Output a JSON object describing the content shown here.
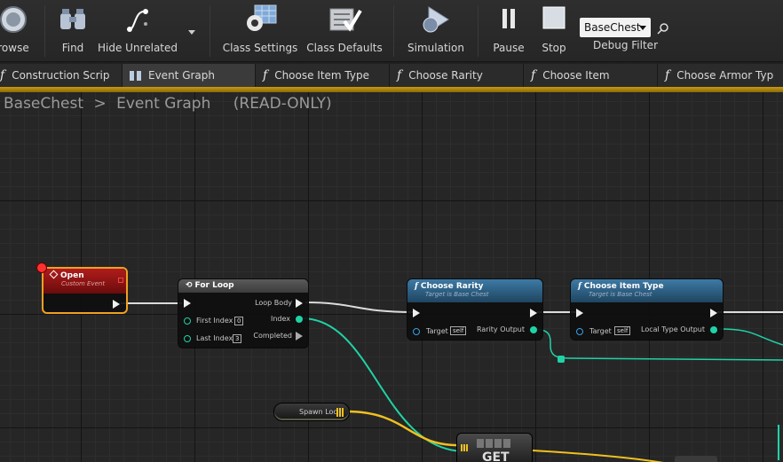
{
  "toolbar": {
    "browse": "rowse",
    "find": "Find",
    "hide_unrelated": "Hide Unrelated",
    "class_settings": "Class Settings",
    "class_defaults": "Class Defaults",
    "simulation": "Simulation",
    "pause": "Pause",
    "stop": "Stop",
    "debug_object": "BaseChest",
    "debug_filter": "Debug Filter"
  },
  "tabs": [
    {
      "label": "Construction Scrip",
      "icon": "function-icon"
    },
    {
      "label": "Event Graph",
      "icon": "graph-icon"
    },
    {
      "label": "Choose Item Type",
      "icon": "function-icon"
    },
    {
      "label": "Choose Rarity",
      "icon": "function-icon"
    },
    {
      "label": "Choose Item",
      "icon": "function-icon"
    },
    {
      "label": "Choose Armor Typ",
      "icon": "function-icon"
    }
  ],
  "breadcrumb": {
    "blueprint": "BaseChest",
    "sep": ">",
    "graph": "Event Graph",
    "mode": "(READ-ONLY)"
  },
  "nodes": {
    "open": {
      "title": "Open",
      "subtitle": "Custom Event"
    },
    "for_loop": {
      "title": "For Loop",
      "first_index_label": "First Index",
      "first_index_value": "0",
      "last_index_label": "Last Index",
      "last_index_value": "3",
      "loop_body": "Loop Body",
      "index": "Index",
      "completed": "Completed"
    },
    "choose_rarity": {
      "title": "Choose Rarity",
      "subtitle": "Target is Base Chest",
      "target_label": "Target",
      "target_value": "self",
      "output": "Rarity Output"
    },
    "choose_item_type": {
      "title": "Choose Item Type",
      "subtitle": "Target is Base Chest",
      "target_label": "Target",
      "target_value": "self",
      "output": "Local Type Output"
    },
    "spawn_loc": {
      "label": "Spawn Loc"
    },
    "get": {
      "label": "GET"
    }
  },
  "colors": {
    "event_header": "#8c1414",
    "function_header": "#2b5a7a",
    "loop_header": "#4a4a4a",
    "int_pin": "#1fd3a6",
    "vector_pin": "#f0c020",
    "tab_bar_accent": "#c99a10"
  }
}
